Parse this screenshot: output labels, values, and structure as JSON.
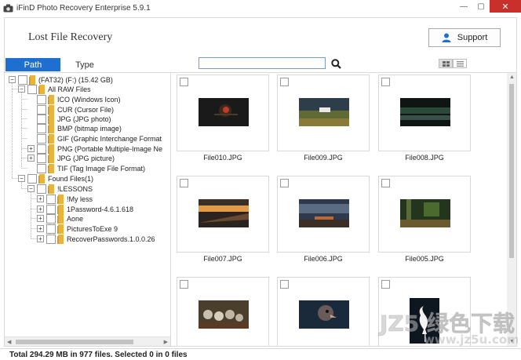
{
  "window": {
    "title": "iFinD Photo Recovery Enterprise 5.9.1",
    "close_glyph": "✕",
    "minimize_glyph": "—",
    "maximize_glyph": "▢"
  },
  "header": {
    "title": "Lost File Recovery",
    "support_label": "Support"
  },
  "tabs": [
    {
      "label": "Path",
      "active": true
    },
    {
      "label": "Type",
      "active": false
    }
  ],
  "search": {
    "value": "",
    "placeholder": ""
  },
  "tree": [
    {
      "label": "(FAT32) (F:) (15.42 GB)",
      "expander": "−"
    },
    {
      "label": "All RAW Files",
      "expander": "−"
    },
    {
      "label": "ICO (Windows Icon)",
      "expander": ""
    },
    {
      "label": "CUR (Cursor File)",
      "expander": ""
    },
    {
      "label": "JPG (JPG photo)",
      "expander": ""
    },
    {
      "label": "BMP (bitmap image)",
      "expander": ""
    },
    {
      "label": "GIF (Graphic Interchange Format",
      "expander": ""
    },
    {
      "label": "PNG (Portable Multiple-Image Ne",
      "expander": "+"
    },
    {
      "label": "JPG (JPG picture)",
      "expander": "+"
    },
    {
      "label": "TIF (Tag Image File Format)",
      "expander": ""
    },
    {
      "label": "Found Files(1)",
      "expander": "−"
    },
    {
      "label": "!LESSONS",
      "expander": "−"
    },
    {
      "label": "!My less",
      "expander": "+"
    },
    {
      "label": "1Password-4.6.1.618",
      "expander": "+"
    },
    {
      "label": "Aone",
      "expander": "+"
    },
    {
      "label": "PicturesToExe 9",
      "expander": "+"
    },
    {
      "label": "RecoverPasswords.1.0.0.26",
      "expander": "+"
    }
  ],
  "files": [
    {
      "name": "File010.JPG",
      "thumb": "bird"
    },
    {
      "name": "File009.JPG",
      "thumb": "landscape"
    },
    {
      "name": "File008.JPG",
      "thumb": "lake"
    },
    {
      "name": "File007.JPG",
      "thumb": "sunset"
    },
    {
      "name": "File006.JPG",
      "thumb": "clouds"
    },
    {
      "name": "File005.JPG",
      "thumb": "forest"
    },
    {
      "name": "",
      "thumb": "lemurs"
    },
    {
      "name": "",
      "thumb": "ostrich"
    },
    {
      "name": "",
      "thumb": "egret"
    }
  ],
  "status": {
    "text": "Total 294.29 MB in 977 files.  Selected 0 in 0 files"
  },
  "colors": {
    "accent": "#1e6fd0",
    "folder": "#e8b53a"
  }
}
